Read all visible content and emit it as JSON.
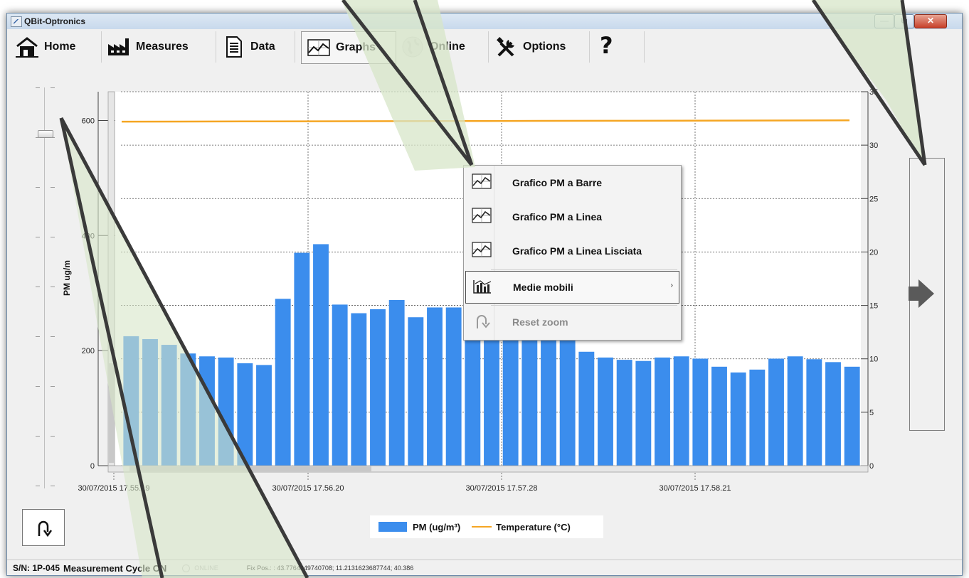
{
  "window": {
    "title": "QBit-Optronics",
    "controls": {
      "minimize": "—",
      "maximize": "⧉",
      "close": "✕"
    }
  },
  "toolbar": {
    "items": [
      {
        "label": "Home",
        "icon": "home-icon"
      },
      {
        "label": "Measures",
        "icon": "factory-icon"
      },
      {
        "label": "Data",
        "icon": "document-icon"
      },
      {
        "label": "Graphs",
        "icon": "chart-icon",
        "active": true
      },
      {
        "label": "Online",
        "icon": "globe-icon"
      },
      {
        "label": "Options",
        "icon": "tools-icon"
      },
      {
        "label": "?",
        "icon": "help-icon"
      }
    ]
  },
  "context_menu": {
    "items": [
      {
        "label": "Grafico PM a Barre",
        "icon": "line-chart-icon"
      },
      {
        "label": "Grafico PM a Linea",
        "icon": "line-chart-icon"
      },
      {
        "label": "Grafico PM a Linea Lisciata",
        "icon": "line-chart-icon"
      },
      {
        "label": "Medie mobili",
        "icon": "bar-chart-icon",
        "submenu": "›",
        "highlighted": true
      },
      {
        "label": "Reset zoom",
        "icon": "undo-icon",
        "disabled": true
      }
    ]
  },
  "chart_data": {
    "type": "bar",
    "ylabel": "PM ug/m",
    "ylim": [
      0,
      650
    ],
    "y_ticks": [
      0,
      200,
      400,
      600
    ],
    "y2lim": [
      0,
      35
    ],
    "y2_ticks": [
      0,
      5,
      10,
      15,
      20,
      25,
      30,
      35
    ],
    "x_tick_labels": [
      "30/07/2015 17.55.19",
      "30/07/2015 17.56.20",
      "30/07/2015 17.57.28",
      "30/07/2015 17.58.21"
    ],
    "grid": true,
    "legend_position": "bottom-center",
    "colors": {
      "pm": "#3b8ded",
      "temperature": "#f5a623"
    },
    "series": [
      {
        "name": "PM (ug/m³)",
        "type": "bar",
        "axis": "left",
        "values": [
          225,
          220,
          210,
          195,
          190,
          188,
          178,
          175,
          290,
          370,
          385,
          280,
          265,
          272,
          288,
          258,
          275,
          275,
          270,
          250,
          240,
          235,
          230,
          220,
          198,
          188,
          184,
          182,
          188,
          190,
          186,
          172,
          162,
          167,
          186,
          190,
          185,
          180,
          172
        ]
      },
      {
        "name": "Temperature (°C)",
        "type": "line",
        "axis": "right",
        "values": [
          32.2,
          32.22,
          32.24,
          32.26,
          32.28,
          32.3,
          32.32
        ]
      }
    ]
  },
  "legend": {
    "pm": "PM (ug/m³)",
    "temperature": "Temperature (°C)"
  },
  "status_bar": {
    "serial": "S/N: 1P-045",
    "cycle": "Measurement Cycle ON",
    "online": "ONLINE",
    "gps": "Fix Pos.: : 43.7764349740708; 11.2131623687744; 40.386"
  }
}
